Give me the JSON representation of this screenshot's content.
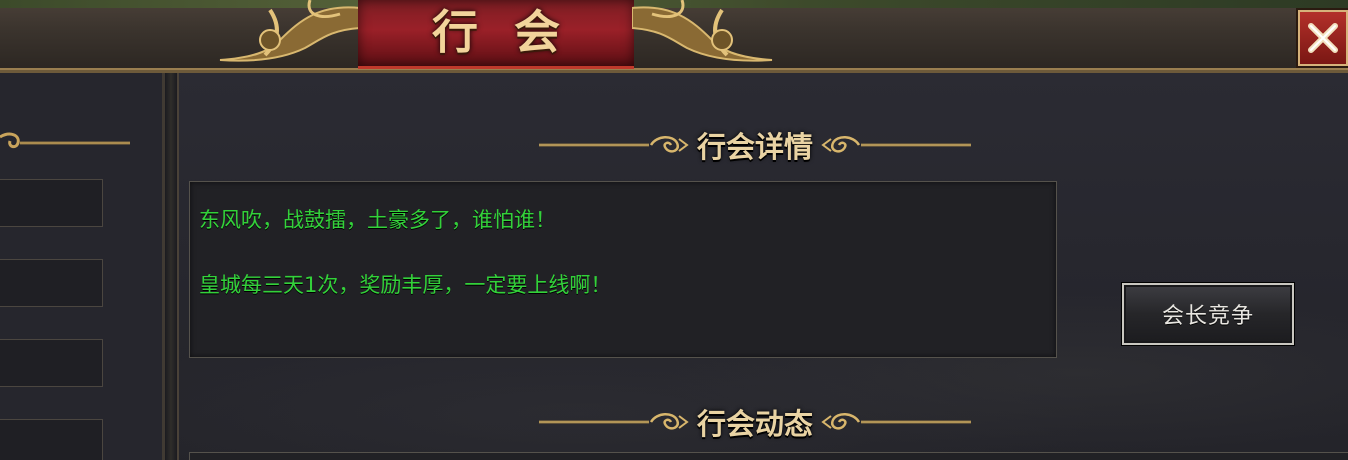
{
  "window": {
    "title": "行会"
  },
  "main": {
    "details_header": "行会详情",
    "details_lines": [
      "东风吹，战鼓擂，土豪多了，谁怕谁！",
      "皇城每三天1次，奖励丰厚，一定要上线啊！"
    ],
    "leader_button": "会长竞争",
    "news_header": "行会动态"
  },
  "colors": {
    "title_plaque": "#9a2028",
    "title_text": "#f2d49b",
    "header_gold": "#e9d3a3",
    "detail_text_green": "#33d13a",
    "ornament_gold": "#c9a45c"
  },
  "icons": [
    "close-icon",
    "gold-ornament-icon"
  ]
}
